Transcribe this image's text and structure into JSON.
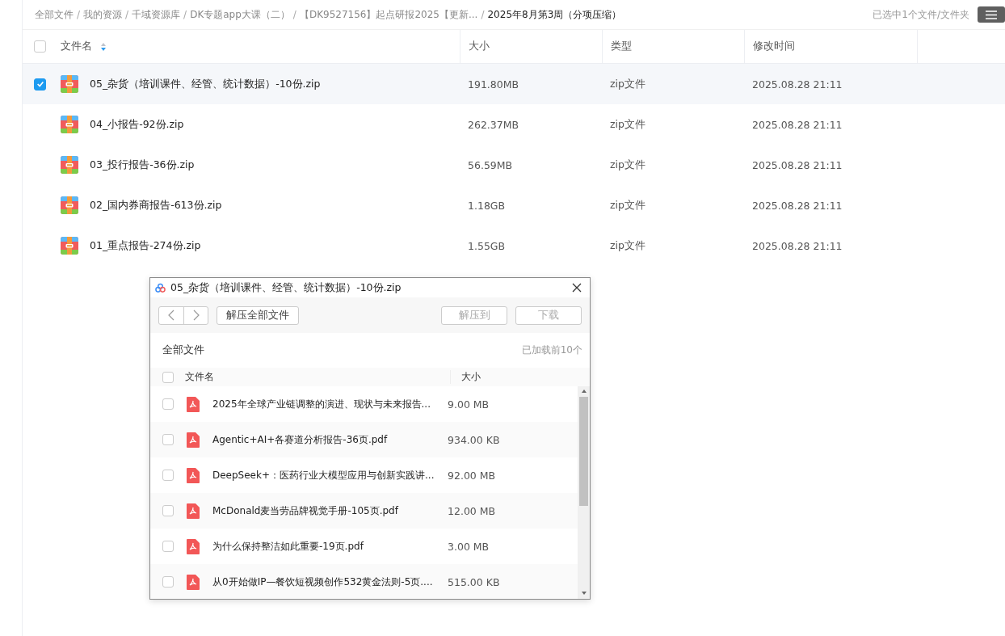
{
  "breadcrumb": {
    "separator": "/",
    "items": [
      {
        "label": "全部文件",
        "current": false
      },
      {
        "label": "我的资源",
        "current": false
      },
      {
        "label": "千域资源库",
        "current": false
      },
      {
        "label": "DK专题app大课（二）",
        "current": false
      },
      {
        "label": "【DK9527156】起点研报2025【更新...",
        "current": false
      },
      {
        "label": "2025年8月第3周（分项压缩）",
        "current": true
      }
    ]
  },
  "selection_status": "已选中1个文件/文件夹",
  "table": {
    "select_all_checked": false,
    "columns": [
      "文件名",
      "大小",
      "类型",
      "修改时间"
    ],
    "rows": [
      {
        "name": "05_杂货（培训课件、经管、统计数据）-10份.zip",
        "size": "191.80MB",
        "type": "zip文件",
        "modified": "2025.08.28 21:11",
        "selected": true
      },
      {
        "name": "04_小报告-92份.zip",
        "size": "262.37MB",
        "type": "zip文件",
        "modified": "2025.08.28 21:11",
        "selected": false
      },
      {
        "name": "03_投行报告-36份.zip",
        "size": "56.59MB",
        "type": "zip文件",
        "modified": "2025.08.28 21:11",
        "selected": false
      },
      {
        "name": "02_国内券商报告-613份.zip",
        "size": "1.18GB",
        "type": "zip文件",
        "modified": "2025.08.28 21:11",
        "selected": false
      },
      {
        "name": "01_重点报告-274份.zip",
        "size": "1.55GB",
        "type": "zip文件",
        "modified": "2025.08.28 21:11",
        "selected": false
      }
    ]
  },
  "preview_window": {
    "title": "05_杂货（培训课件、经管、统计数据）-10份.zip",
    "buttons": [
      {
        "label": "解压全部文件",
        "disabled": false
      },
      {
        "label": "解压到",
        "disabled": true
      },
      {
        "label": "下载",
        "disabled": true
      }
    ],
    "path": "全部文件",
    "loaded_note": "已加载前10个",
    "select_all_checked": false,
    "columns": [
      "文件名",
      "大小"
    ],
    "files": [
      {
        "name": "2025年全球产业链调整的演进、现状与未来报告...",
        "size": "9.00 MB",
        "checked": false
      },
      {
        "name": "Agentic+AI+各赛道分析报告-36页.pdf",
        "size": "934.00 KB",
        "checked": false
      },
      {
        "name": "DeepSeek+：医药行业大模型应用与创新实践讲...",
        "size": "92.00 MB",
        "checked": false
      },
      {
        "name": "McDonald麦当劳品牌视觉手册-105页.pdf",
        "size": "12.00 MB",
        "checked": false
      },
      {
        "name": "为什么保持整洁如此重要-19页.pdf",
        "size": "3.00 MB",
        "checked": false
      },
      {
        "name": "从0开始做IP—餐饮短视频创作532黄金法则-5页....",
        "size": "515.00 KB",
        "checked": false
      }
    ]
  }
}
